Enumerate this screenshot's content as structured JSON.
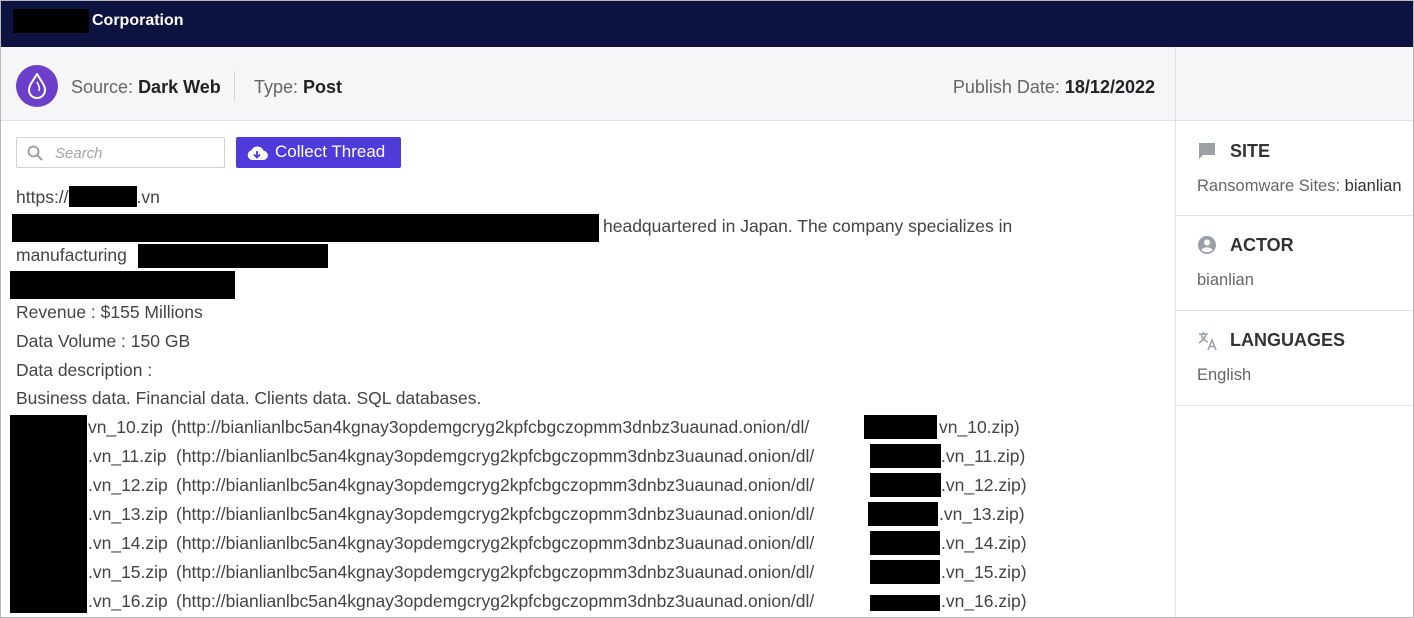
{
  "header": {
    "title": "Corporation"
  },
  "meta": {
    "source_label": "Source:",
    "source_value": "Dark Web",
    "type_label": "Type:",
    "type_value": "Post",
    "publish_label": "Publish Date:",
    "publish_value": "18/12/2022"
  },
  "toolbar": {
    "search_placeholder": "Search",
    "collect_label": "Collect Thread"
  },
  "post": {
    "url_prefix": "https://",
    "url_suffix": ".vn",
    "intro_tail": "headquartered in Japan. The company specializes in",
    "manufacturing": "manufacturing",
    "revenue": "Revenue : $155 Millions",
    "volume": "Data Volume : 150 GB",
    "desc_label": "Data description :",
    "desc_value": "Business data. Financial data. Clients data. SQL databases.",
    "files": [
      {
        "name": "vn_10.zip",
        "link_prefix": "(http://bianlianlbc5an4kgnay3opdemgcryg2kpfcbgczopmm3dnbz3uaunad.onion/dl/",
        "link_suffix": "vn_10.zip)"
      },
      {
        "name": ".vn_11.zip",
        "link_prefix": "(http://bianlianlbc5an4kgnay3opdemgcryg2kpfcbgczopmm3dnbz3uaunad.onion/dl/",
        "link_suffix": ".vn_11.zip)"
      },
      {
        "name": ".vn_12.zip",
        "link_prefix": "(http://bianlianlbc5an4kgnay3opdemgcryg2kpfcbgczopmm3dnbz3uaunad.onion/dl/",
        "link_suffix": ".vn_12.zip)"
      },
      {
        "name": ".vn_13.zip",
        "link_prefix": "(http://bianlianlbc5an4kgnay3opdemgcryg2kpfcbgczopmm3dnbz3uaunad.onion/dl/",
        "link_suffix": ".vn_13.zip)"
      },
      {
        "name": ".vn_14.zip",
        "link_prefix": "(http://bianlianlbc5an4kgnay3opdemgcryg2kpfcbgczopmm3dnbz3uaunad.onion/dl/",
        "link_suffix": ".vn_14.zip)"
      },
      {
        "name": ".vn_15.zip",
        "link_prefix": "(http://bianlianlbc5an4kgnay3opdemgcryg2kpfcbgczopmm3dnbz3uaunad.onion/dl/",
        "link_suffix": ".vn_15.zip)"
      },
      {
        "name": ".vn_16.zip",
        "link_prefix": "(http://bianlianlbc5an4kgnay3opdemgcryg2kpfcbgczopmm3dnbz3uaunad.onion/dl/",
        "link_suffix": ".vn_16.zip)"
      }
    ]
  },
  "sidebar": {
    "site_heading": "SITE",
    "site_label": "Ransomware Sites:",
    "site_value": "bianlian",
    "actor_heading": "ACTOR",
    "actor_value": "bianlian",
    "lang_heading": "LANGUAGES",
    "lang_value": "English",
    "icons": [
      "chat-icon",
      "account-icon",
      "translate-icon"
    ]
  },
  "colors": {
    "topbar": "#0c1341",
    "accent": "#4f3bdb",
    "logo": "#6b3fc9"
  }
}
